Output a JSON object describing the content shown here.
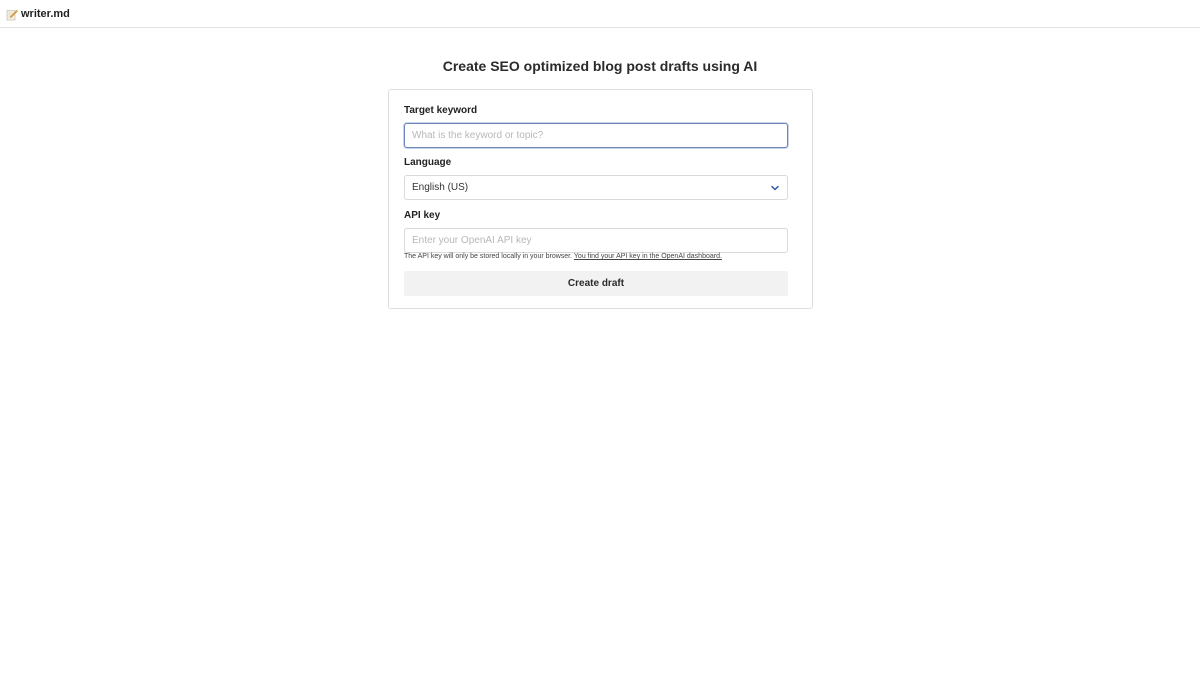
{
  "header": {
    "brand_icon": "pencil-memo-icon",
    "brand_name": "writer.md"
  },
  "page": {
    "title": "Create SEO optimized blog post drafts using AI"
  },
  "form": {
    "keyword": {
      "label": "Target keyword",
      "value": "",
      "placeholder": "What is the keyword or topic?"
    },
    "language": {
      "label": "Language",
      "selected": "English (US)",
      "icon": "chevron-down-icon"
    },
    "api_key": {
      "label": "API key",
      "value": "",
      "placeholder": "Enter your OpenAI API key",
      "hint_text": "The API key will only be stored locally in your browser. ",
      "hint_link": "You find your API key in the OpenAI dashboard."
    },
    "submit_label": "Create draft"
  },
  "colors": {
    "focus_border": "#6f86b8",
    "chevron": "#2f5aa8",
    "button_bg": "#f2f2f2"
  }
}
